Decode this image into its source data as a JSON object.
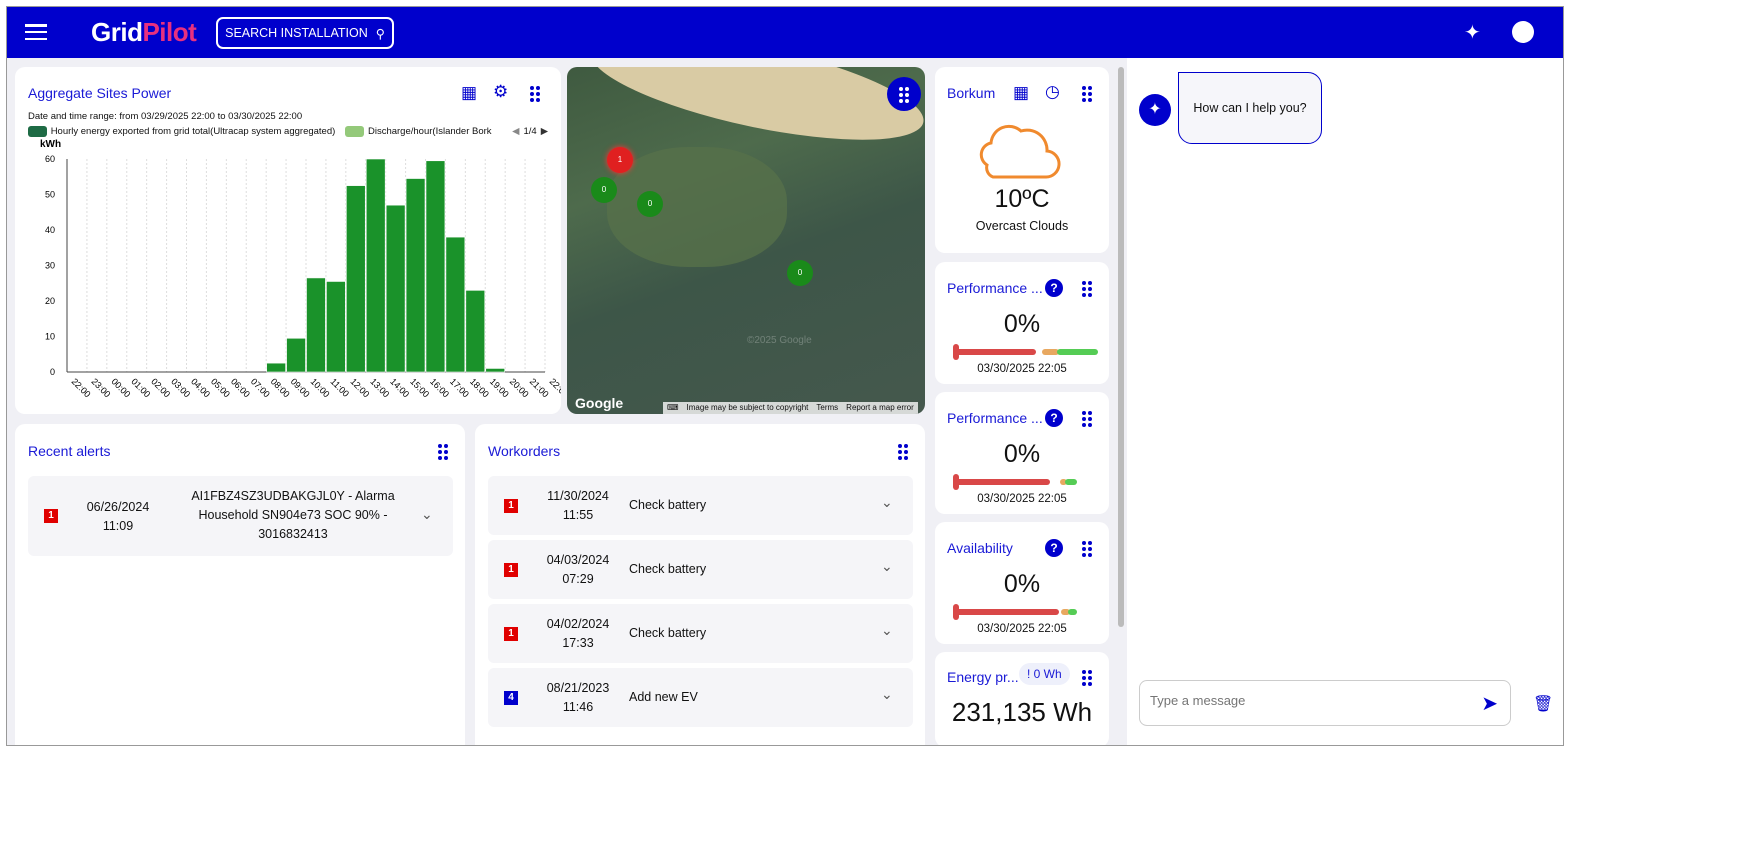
{
  "header": {
    "brand_first": "Grid",
    "brand_second": "Pilot",
    "search_label": "SEARCH INSTALLATION",
    "brand_color": "#0000cc",
    "accent": "#e8307f"
  },
  "chart_card": {
    "title": "Aggregate Sites Power",
    "range": "Date and time range: from 03/29/2025 22:00 to 03/30/2025 22:00",
    "page": "1/4"
  },
  "chart_data": {
    "type": "bar",
    "ylabel": "kWh",
    "ylim": [
      0,
      60
    ],
    "yticks": [
      0,
      10,
      20,
      30,
      40,
      50,
      60
    ],
    "grid": "vertical",
    "legend_position": "top",
    "categories": [
      "22:00",
      "23:00",
      "00:00",
      "01:00",
      "02:00",
      "03:00",
      "04:00",
      "05:00",
      "06:00",
      "07:00",
      "08:00",
      "09:00",
      "10:00",
      "11:00",
      "12:00",
      "13:00",
      "14:00",
      "15:00",
      "16:00",
      "17:00",
      "18:00",
      "19:00",
      "20:00",
      "21:00",
      "22:00"
    ],
    "series": [
      {
        "name": "Hourly energy exported from grid total(Ultracap system aggregated)",
        "color": "#1e6b45",
        "values": [
          0,
          0,
          0,
          0,
          0,
          0,
          0,
          0,
          0,
          0,
          2.5,
          9.5,
          26.5,
          25.5,
          52.5,
          60,
          47,
          54.5,
          59.5,
          38,
          23,
          1,
          0,
          0
        ]
      },
      {
        "name": "Discharge/hour(Islander Bork",
        "color": "#94c97a",
        "values": []
      }
    ],
    "bar_color": "#1a922a"
  },
  "map": {
    "clusters": [
      {
        "count": "1",
        "status": "alert"
      },
      {
        "count": "0",
        "status": "ok"
      },
      {
        "count": "0",
        "status": "ok"
      },
      {
        "count": "0",
        "status": "ok"
      }
    ],
    "google": "Google",
    "copyright": "Image may be subject to copyright",
    "terms": "Terms",
    "report": "Report a map error",
    "watermark": "©2025 Google"
  },
  "weather": {
    "title": "Borkum",
    "temp": "10ºC",
    "desc": "Overcast Clouds"
  },
  "kpis": [
    {
      "title": "Performance ...",
      "value": "0%",
      "date": "03/30/2025 22:05"
    },
    {
      "title": "Performance ...",
      "value": "0%",
      "date": "03/30/2025 22:05"
    },
    {
      "title": "Availability",
      "value": "0%",
      "date": "03/30/2025 22:05"
    }
  ],
  "energy": {
    "title": "Energy pr...",
    "chip": "! 0 Wh",
    "value": "231,135 Wh"
  },
  "alerts": {
    "title": "Recent alerts",
    "items": [
      {
        "badge": "1",
        "date": "06/26/2024",
        "time": "11:09",
        "text": "AI1FBZ4SZ3UDBAKGJL0Y - Alarma Household SN904e73 SOC 90% - 3016832413"
      }
    ]
  },
  "workorders": {
    "title": "Workorders",
    "items": [
      {
        "badge": "1",
        "date": "11/30/2024",
        "time": "11:55",
        "text": "Check battery",
        "color": "#e00000"
      },
      {
        "badge": "1",
        "date": "04/03/2024",
        "time": "07:29",
        "text": "Check battery",
        "color": "#e00000"
      },
      {
        "badge": "1",
        "date": "04/02/2024",
        "time": "17:33",
        "text": "Check battery",
        "color": "#e00000"
      },
      {
        "badge": "4",
        "date": "08/21/2023",
        "time": "11:46",
        "text": "Add new EV",
        "color": "#0000cc"
      }
    ]
  },
  "chat": {
    "greeting": "How can I help you?",
    "placeholder": "Type a message"
  }
}
